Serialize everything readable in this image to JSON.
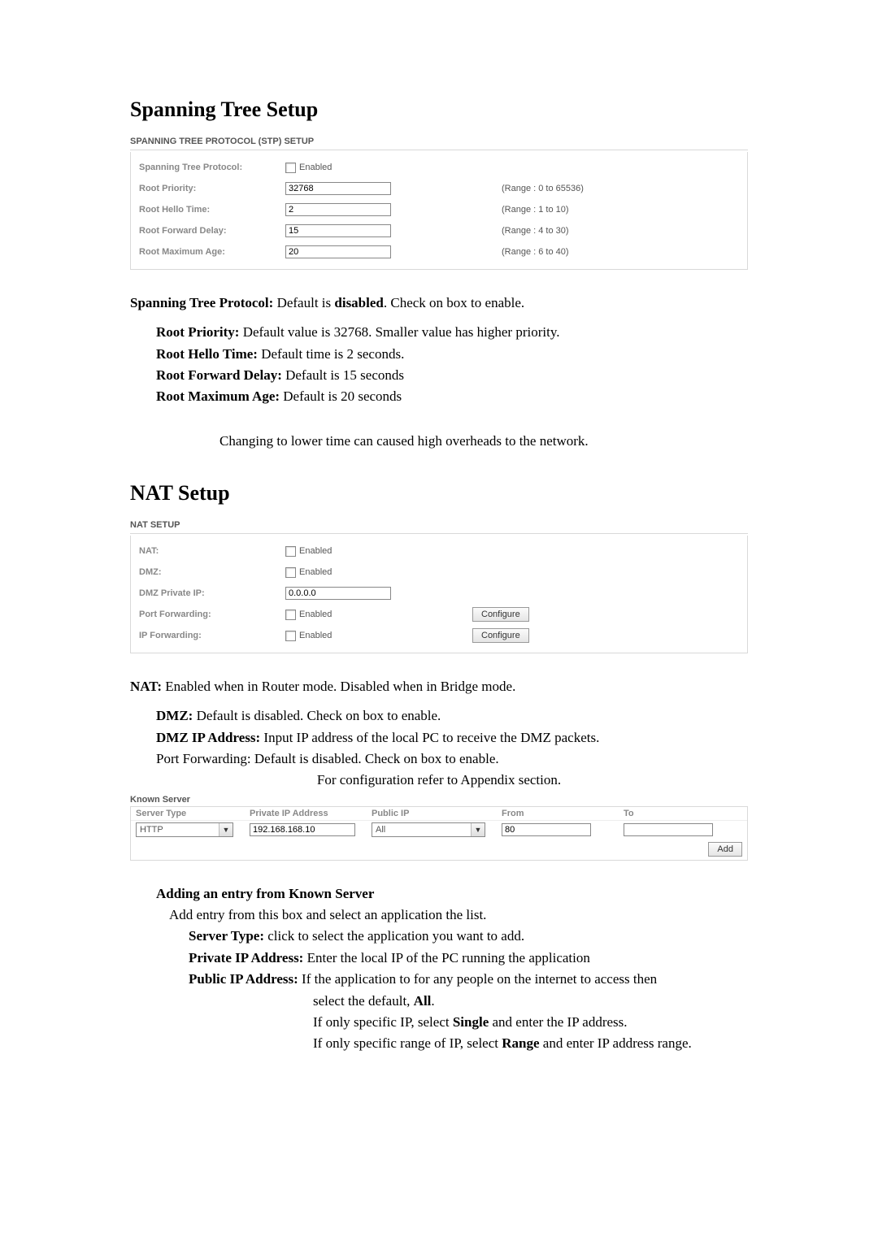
{
  "sections": {
    "stp_title": "Spanning Tree Setup",
    "nat_title": "NAT Setup"
  },
  "stp_panel": {
    "heading": "SPANNING TREE PROTOCOL (STP) SETUP",
    "rows": {
      "protocol_label": "Spanning Tree Protocol:",
      "enabled_label": "Enabled",
      "priority_label": "Root Priority:",
      "priority_value": "32768",
      "priority_range": "(Range : 0 to 65536)",
      "hello_label": "Root Hello Time:",
      "hello_value": "2",
      "hello_range": "(Range : 1 to 10)",
      "forward_label": "Root Forward Delay:",
      "forward_value": "15",
      "forward_range": "(Range : 4 to 30)",
      "maxage_label": "Root Maximum Age:",
      "maxage_value": "20",
      "maxage_range": "(Range : 6 to 40)"
    }
  },
  "stp_text": {
    "line1_bold": "Spanning Tree Protocol:",
    "line1_rest_a": " Default is ",
    "line1_bold2": "disabled",
    "line1_rest_b": ". Check on box to enable.",
    "priority_bold": "Root Priority:",
    "priority_rest": " Default value is 32768. Smaller value has higher priority.",
    "hello_bold": "Root Hello Time:",
    "hello_rest": " Default time is 2 seconds.",
    "forward_bold": "Root Forward Delay:",
    "forward_rest": " Default is 15 seconds",
    "maxage_bold": "Root Maximum Age:",
    "maxage_rest": " Default is 20 seconds",
    "note": "Changing to lower time can caused high overheads to the network."
  },
  "nat_panel": {
    "heading": "NAT SETUP",
    "nat_label": "NAT:",
    "dmz_label": "DMZ:",
    "dmz_ip_label": "DMZ Private IP:",
    "dmz_ip_value": "0.0.0.0",
    "pf_label": "Port Forwarding:",
    "ipfwd_label": "IP Forwarding:",
    "enabled_label": "Enabled",
    "configure_label": "Configure"
  },
  "nat_text": {
    "line1_bold": "NAT:",
    "line1_rest": " Enabled when in Router mode. Disabled when in Bridge mode.",
    "dmz_bold": "DMZ:",
    "dmz_rest": " Default is disabled. Check on box to enable.",
    "dmzip_bold": "DMZ IP Address:",
    "dmzip_rest": " Input IP address of the local PC to receive the DMZ packets.",
    "pf_line": "Port Forwarding: Default is disabled. Check on box to enable.",
    "appendix": "For configuration refer to Appendix section."
  },
  "known_server": {
    "heading": "Known Server",
    "headers": {
      "type": "Server Type",
      "priv": "Private IP Address",
      "pub": "Public IP",
      "from": "From",
      "to": "To"
    },
    "row": {
      "type_value": "HTTP",
      "priv_value": "192.168.168.10",
      "pub_value": "All",
      "from_value": "80",
      "to_value": ""
    },
    "add_label": "Add"
  },
  "ks_text": {
    "heading_bold": "Adding an entry from Known Server",
    "line1": "Add entry from this box and select an application the list.",
    "st_bold": "Server Type:",
    "st_rest": " click to select the application you want to add.",
    "priv_bold": "Private IP Address:",
    "priv_rest": " Enter the local IP of the PC running the application",
    "pub_bold": "Public IP Address:",
    "pub_rest": " If the application to for any people on the internet to access then",
    "pub_line2a": "select the default, ",
    "pub_line2b": "All",
    "pub_line2c": ".",
    "pub_line3a": "If only specific IP, select ",
    "pub_line3b": "Single",
    "pub_line3c": " and enter the IP address.",
    "pub_line4a": "If only specific range of IP, select ",
    "pub_line4b": "Range",
    "pub_line4c": " and enter IP address range."
  }
}
